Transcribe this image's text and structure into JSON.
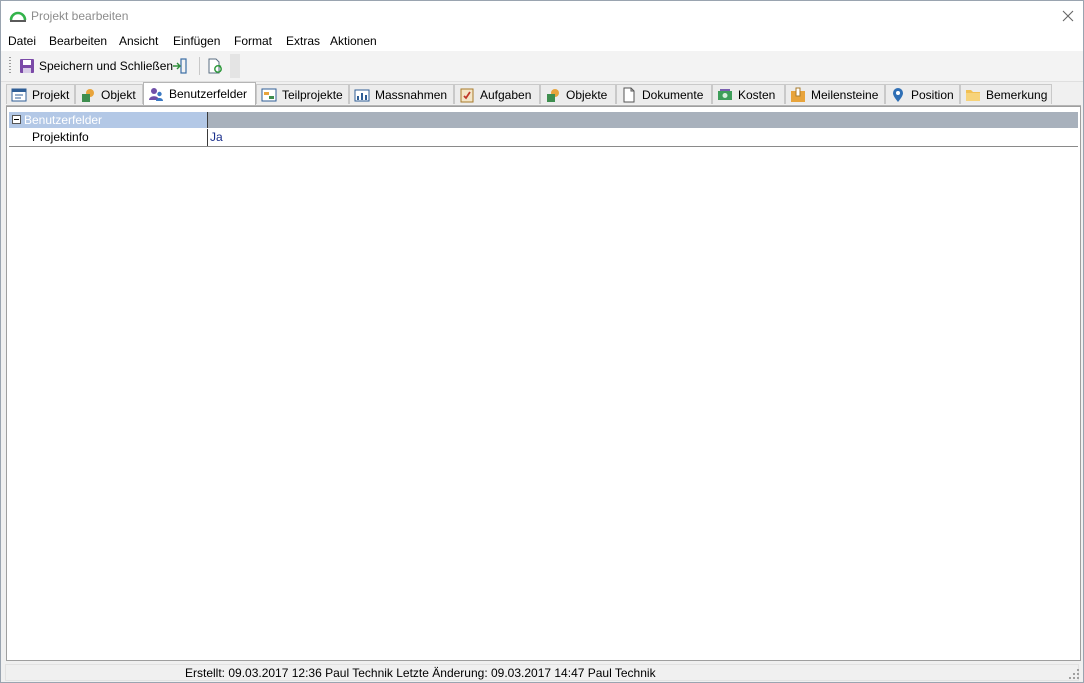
{
  "window": {
    "title": "Projekt bearbeiten",
    "accent_color": "#33b34a"
  },
  "menu": {
    "items": [
      {
        "label": "Datei",
        "accel": "D"
      },
      {
        "label": "Bearbeiten",
        "accel": "B"
      },
      {
        "label": "Ansicht",
        "accel": "A"
      },
      {
        "label": "Einfügen",
        "accel": "E"
      },
      {
        "label": "Format",
        "accel": "F"
      },
      {
        "label": "Extras",
        "accel": "x"
      },
      {
        "label": "Aktionen",
        "accel": "k"
      }
    ]
  },
  "toolbar": {
    "save_close_label": "Speichern und Schließen",
    "save_icon": "floppy-disk-icon",
    "exit_icon": "exit-door-icon",
    "refresh_icon": "document-refresh-icon"
  },
  "tabs": [
    {
      "label": "Projekt",
      "icon": "project-form-icon",
      "active": false
    },
    {
      "label": "Objekt",
      "icon": "object-shapes-icon",
      "active": false
    },
    {
      "label": "Benutzerfelder",
      "icon": "users-icon",
      "active": true
    },
    {
      "label": "Teilprojekte",
      "icon": "subprojects-icon",
      "active": false
    },
    {
      "label": "Massnahmen",
      "icon": "measures-icon",
      "active": false
    },
    {
      "label": "Aufgaben",
      "icon": "task-clipboard-icon",
      "active": false
    },
    {
      "label": "Objekte",
      "icon": "objects-shapes-icon",
      "active": false
    },
    {
      "label": "Dokumente",
      "icon": "document-icon",
      "active": false
    },
    {
      "label": "Kosten",
      "icon": "costs-money-icon",
      "active": false
    },
    {
      "label": "Meilensteine",
      "icon": "milestone-box-icon",
      "active": false
    },
    {
      "label": "Position",
      "icon": "map-pin-icon",
      "active": false
    },
    {
      "label": "Bemerkung",
      "icon": "note-folder-icon",
      "active": false
    }
  ],
  "property_grid": {
    "category": "Benutzerfelder",
    "rows": [
      {
        "name": "Projektinfo",
        "value": "Ja"
      }
    ]
  },
  "status": {
    "text": "Erstellt: 09.03.2017 12:36 Paul Technik  Letzte Änderung: 09.03.2017 14:47 Paul Technik"
  }
}
